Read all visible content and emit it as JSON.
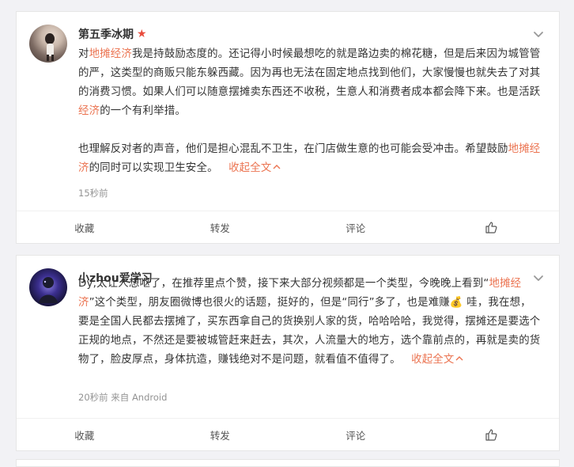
{
  "posts": [
    {
      "username": "第五季冰期",
      "verified_star": "★",
      "paragraphs": [
        [
          {
            "t": "对",
            "h": false
          },
          {
            "t": "地摊经济",
            "h": true
          },
          {
            "t": "我是持鼓励态度的。还记得小时候最想吃的就是路边卖的棉花糖，但是后来因为城管管的严，这类型的商贩只能东躲西藏。因为再也无法在固定地点找到他们，大家慢慢也就失去了对其的消费习惯。如果人们可以随意摆摊卖东西还不收税，生意人和消费者成本都会降下来。也是活跃",
            "h": false
          },
          {
            "t": "经济",
            "h": true
          },
          {
            "t": "的一个有利举措。",
            "h": false
          }
        ],
        [
          {
            "t": "也理解反对者的声音，他们是担心混乱不卫生，在门店做生意的也可能会受冲击。希望鼓励",
            "h": false
          },
          {
            "t": "地摊经济",
            "h": true
          },
          {
            "t": "的同时可以实现卫生安全。",
            "h": false
          }
        ]
      ],
      "collapse_label": "收起全文",
      "meta": "15秒前",
      "actions": {
        "favorite": "收藏",
        "repost": "转发",
        "comment": "评论"
      }
    },
    {
      "username": "小zhou爱学习",
      "paragraphs": [
        [
          {
            "t": "Dy,太让人想呕了，在推荐里点个赞，接下来大部分视频都是一个类型，今晚晚上看到“",
            "h": false
          },
          {
            "t": "地摊经济",
            "h": true
          },
          {
            "t": "”这个类型，朋友圈微博也很火的话题，挺好的，但是“同行”多了，也是难赚💰 哇，我在想，要是全国人民都去摆摊了，买东西拿自己的货换别人家的货，哈哈哈哈，我觉得，摆摊还是要选个正规的地点，不然还是要被城管赶来赶去，其次，人流量大的地方，选个靠前点的，再就是卖的货物了，脸皮厚点，身体抗造，赚钱绝对不是问题，就看值不值得了。",
            "h": false
          }
        ]
      ],
      "collapse_label": "收起全文",
      "meta": "20秒前 来自 Android",
      "actions": {
        "favorite": "收藏",
        "repost": "转发",
        "comment": "评论"
      }
    }
  ],
  "icons": {
    "expand": "chevron-down-icon",
    "like": "thumbs-up-icon",
    "collapse": "chevron-up-icon"
  },
  "colors": {
    "highlight": "#eb7350",
    "star": "#e84c3d",
    "meta": "#939393"
  }
}
